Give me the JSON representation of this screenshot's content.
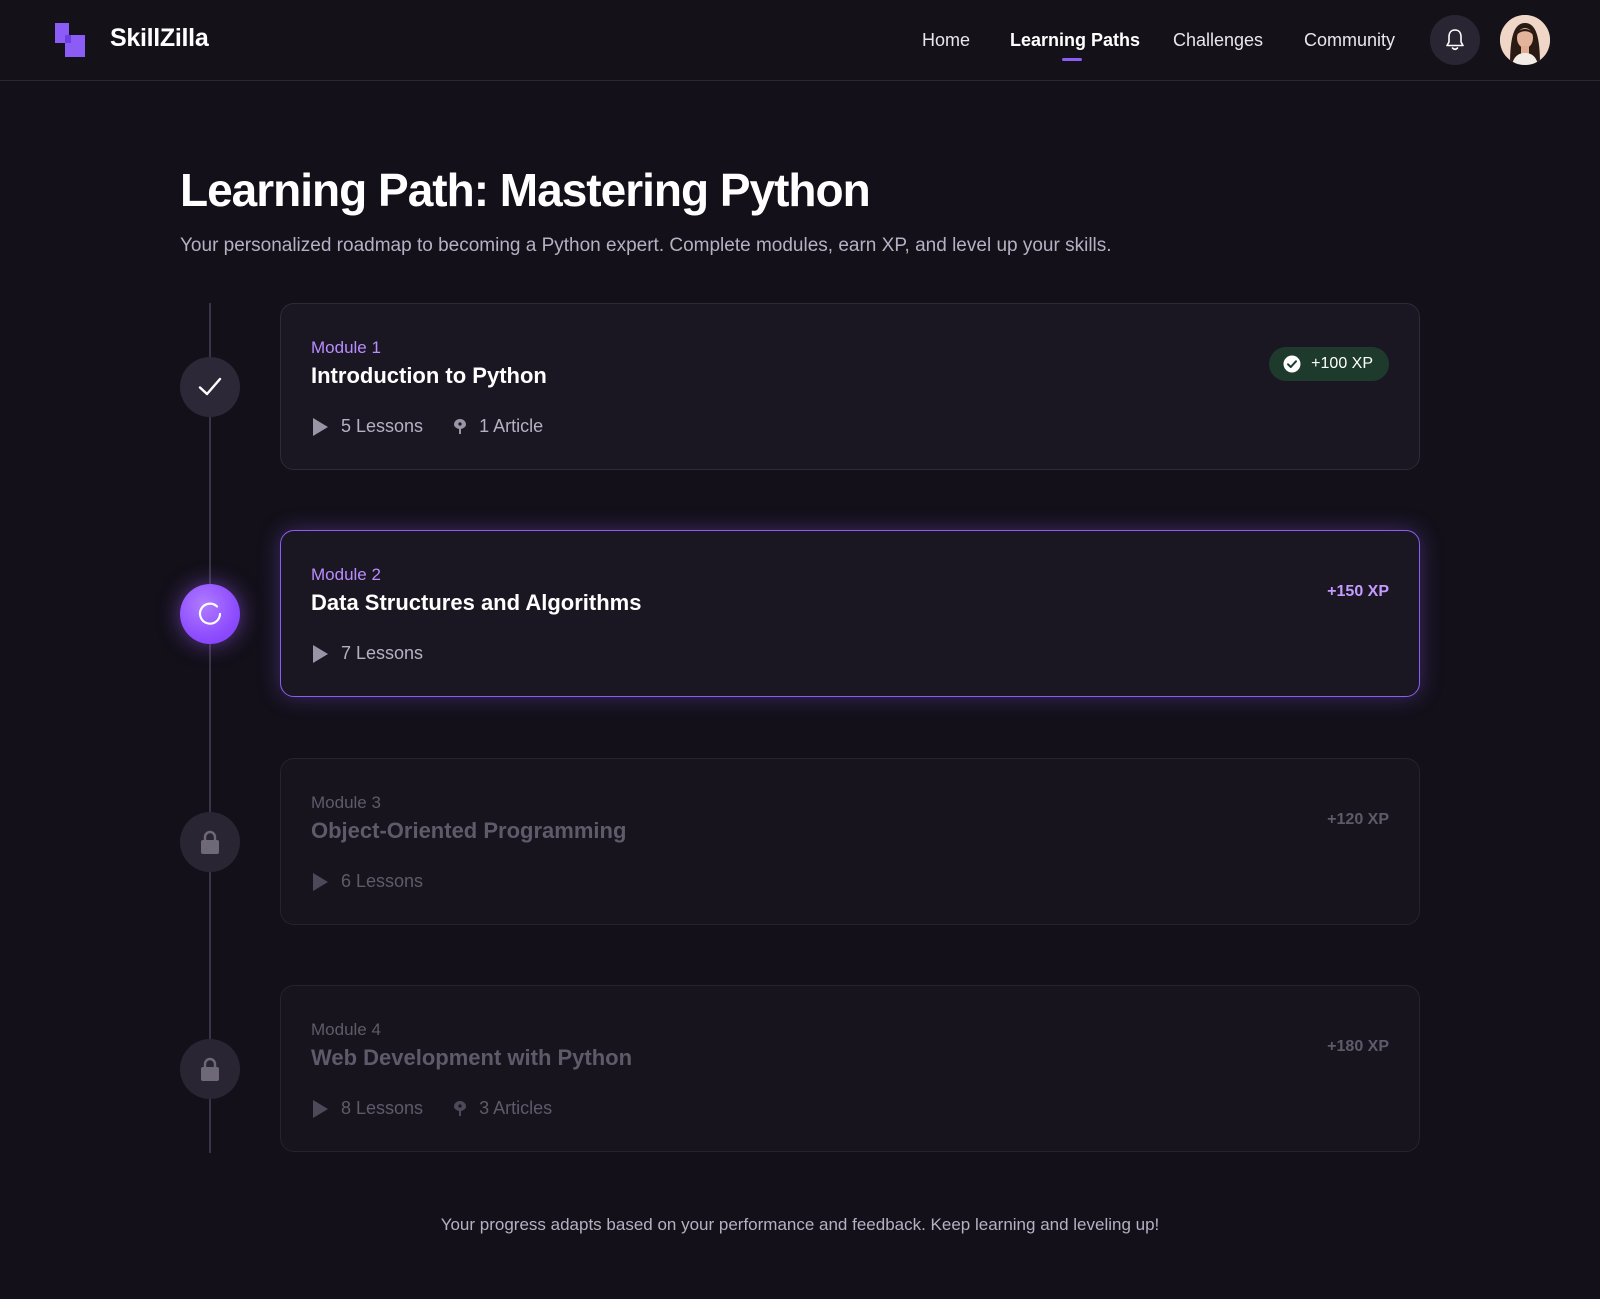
{
  "app": {
    "brand": "SkillZilla"
  },
  "nav": {
    "items": [
      {
        "label": "Home"
      },
      {
        "label": "Learning Paths"
      },
      {
        "label": "Challenges"
      },
      {
        "label": "Community"
      }
    ],
    "active_index": 1
  },
  "colors": {
    "accent": "#8b5cf6",
    "background": "#131019",
    "card": "#1a1722",
    "success_badge": "#1d3a2c",
    "muted_text": "#b6b0c2"
  },
  "page": {
    "title": "Learning Path: Mastering Python",
    "subtitle": "Your personalized roadmap to becoming a Python expert. Complete modules, earn XP, and level up your skills."
  },
  "modules": [
    {
      "label": "Module 1",
      "title": "Introduction to Python",
      "status": "completed",
      "xp": "+100 XP",
      "lessons": "5 Lessons",
      "articles": "1 Article",
      "node_icon": "check-icon"
    },
    {
      "label": "Module 2",
      "title": "Data Structures and Algorithms",
      "status": "in-progress",
      "xp": "+150 XP",
      "lessons": "7 Lessons",
      "node_icon": "progress-spinner-icon"
    },
    {
      "label": "Module 3",
      "title": "Object-Oriented Programming",
      "status": "locked",
      "xp": "+120 XP",
      "lessons": "6 Lessons",
      "node_icon": "lock-icon"
    },
    {
      "label": "Module 4",
      "title": "Web Development with Python",
      "status": "locked",
      "xp": "+180 XP",
      "lessons": "8 Lessons",
      "articles": "3 Articles",
      "node_icon": "lock-icon"
    }
  ],
  "footer": {
    "note": "Your progress adapts based on your performance and feedback. Keep learning and leveling up!"
  }
}
